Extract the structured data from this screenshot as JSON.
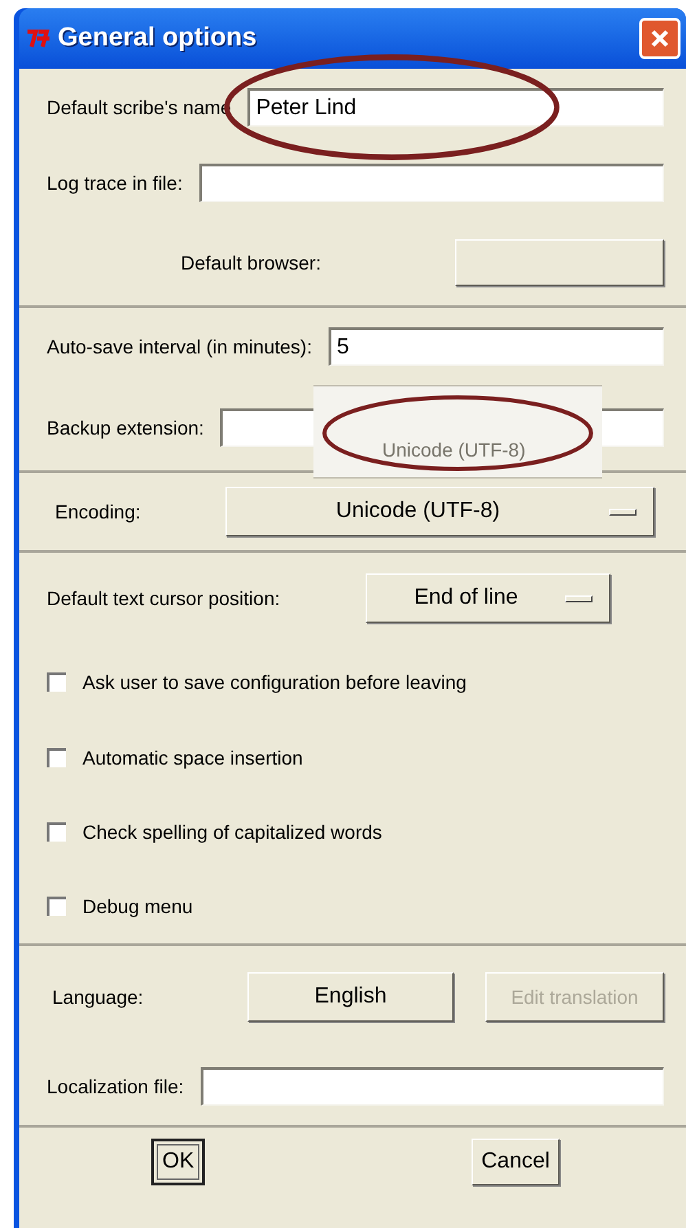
{
  "window": {
    "title": "General options"
  },
  "sections": [
    {
      "rows": [
        {
          "kind": "entry",
          "label": "Default scribe's name",
          "value": "Peter Lind",
          "highlighted": true
        },
        {
          "kind": "entry",
          "label": "Log trace in file:"
        },
        {
          "kind": "button-row",
          "label": "Default browser:"
        }
      ]
    },
    {
      "rows": [
        {
          "kind": "entry",
          "label": "Auto-save interval (in minutes):",
          "value": "5"
        },
        {
          "kind": "entry",
          "label": "Backup extension:"
        }
      ]
    },
    {
      "rows": [
        {
          "kind": "menu",
          "label": "Encoding:",
          "value": "Unicode (UTF-8)"
        }
      ]
    },
    {
      "rows": [
        {
          "kind": "menu",
          "label": "Default text cursor position:",
          "value": "End of line"
        },
        {
          "kind": "check",
          "label": "Ask user to save configuration before leaving",
          "checked": false
        },
        {
          "kind": "check",
          "label": "Automatic space insertion",
          "checked": false
        },
        {
          "kind": "check",
          "label": "Check spelling of capitalized words",
          "checked": false
        },
        {
          "kind": "check",
          "label": "Debug menu",
          "checked": false
        }
      ]
    },
    {
      "rows": [
        {
          "kind": "language",
          "label": "Language:",
          "value": "English",
          "action": {
            "label": "Edit translation",
            "disabled": true
          }
        },
        {
          "kind": "entry",
          "label": "Localization file:"
        }
      ]
    }
  ],
  "callout": {
    "text": "Unicode (UTF-8)"
  },
  "buttons": [
    {
      "label": "OK",
      "default": true
    },
    {
      "label": "Cancel",
      "default": false
    }
  ]
}
